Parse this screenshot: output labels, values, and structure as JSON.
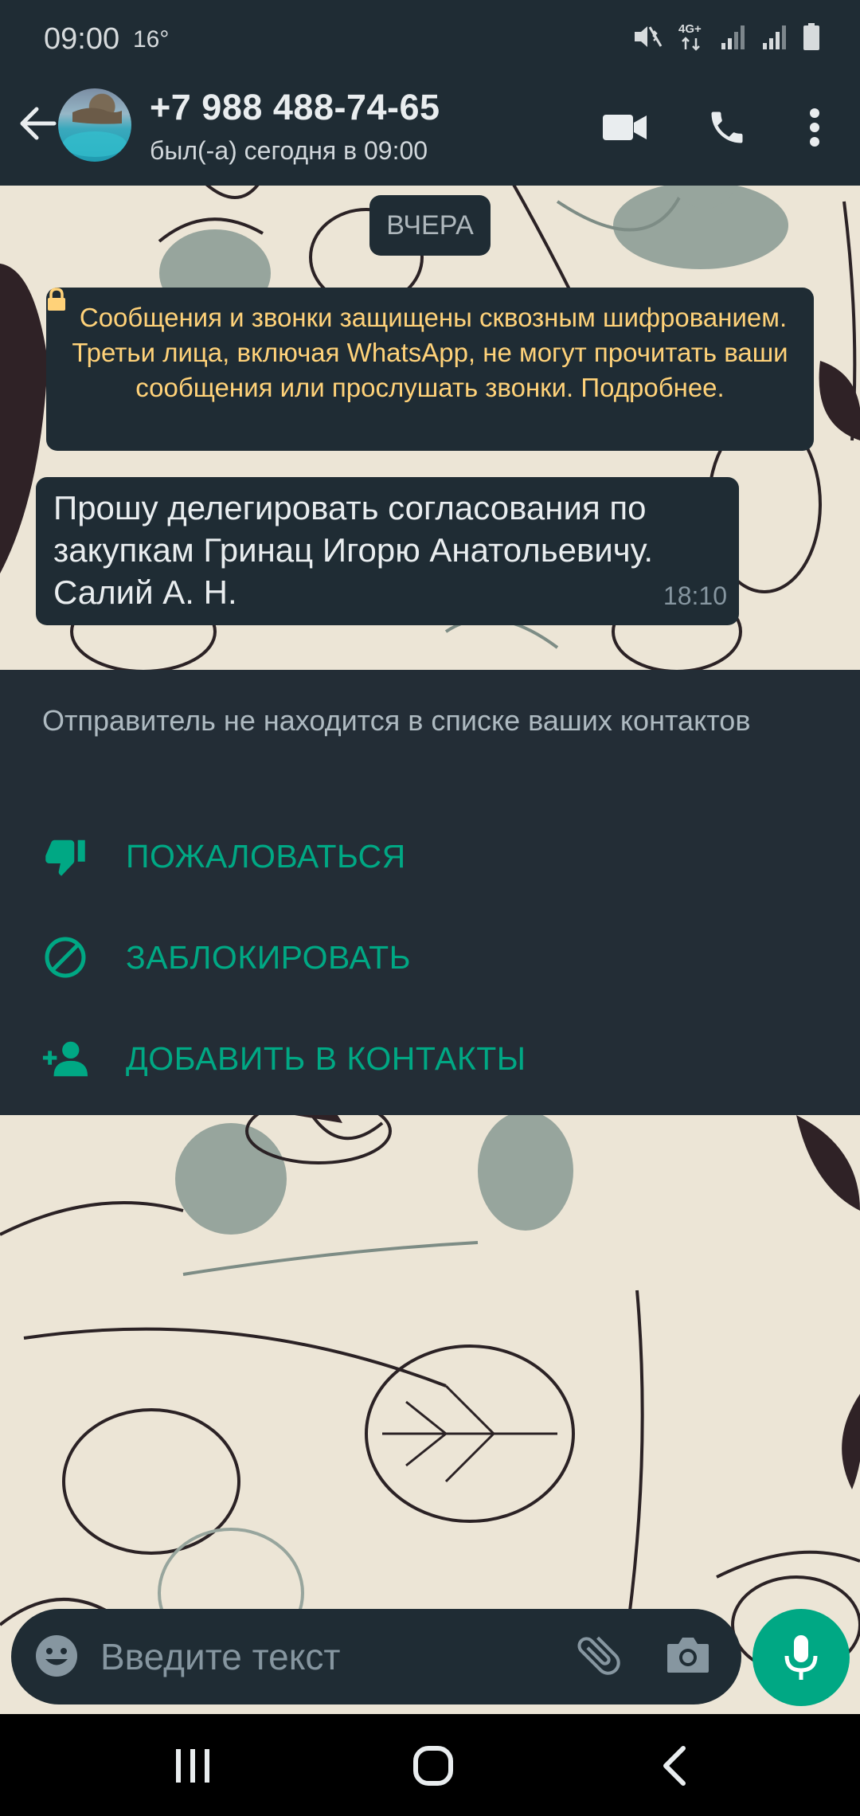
{
  "status_bar": {
    "time": "09:00",
    "temperature": "16°",
    "network": "4G+",
    "icons": [
      "mute-vibrate-icon",
      "network-4g-icon",
      "signal-icon",
      "signal-icon",
      "battery-icon"
    ]
  },
  "header": {
    "contact_name": "+7 988 488-74-65",
    "last_seen": "был(-а) сегодня в 09:00",
    "icons": [
      "back-arrow-icon",
      "video-call-icon",
      "phone-icon",
      "more-vert-icon"
    ]
  },
  "chat": {
    "date_chip": "ВЧЕРА",
    "encryption_notice": "Сообщения и звонки защищены сквозным шифрованием. Третьи лица, включая WhatsApp, не могут прочитать ваши сообщения или прослушать звонки. Подробнее.",
    "messages": [
      {
        "text": "Прошу делегировать согласования по закупкам Гринац Игорю Анатольевичу.       Салий А. Н.",
        "time": "18:10"
      }
    ]
  },
  "unknown_sender": {
    "note": "Отправитель не находится в списке ваших контактов",
    "actions": [
      {
        "label": "ПОЖАЛОВАТЬСЯ",
        "icon": "thumb-down-icon"
      },
      {
        "label": "ЗАБЛОКИРОВАТЬ",
        "icon": "block-icon"
      },
      {
        "label": "ДОБАВИТЬ В КОНТАКТЫ",
        "icon": "add-person-icon"
      }
    ]
  },
  "composer": {
    "placeholder": "Введите текст",
    "icons": [
      "emoji-icon",
      "attach-icon",
      "camera-icon",
      "mic-icon"
    ]
  },
  "colors": {
    "accent": "#00a884",
    "header_bg": "#1f2c34",
    "panel_bg": "#232d36",
    "notice_text": "#ffd279",
    "wallpaper": "#ece5d6"
  },
  "nav_bar": {
    "icons": [
      "recent-apps-icon",
      "home-icon",
      "back-icon"
    ]
  }
}
